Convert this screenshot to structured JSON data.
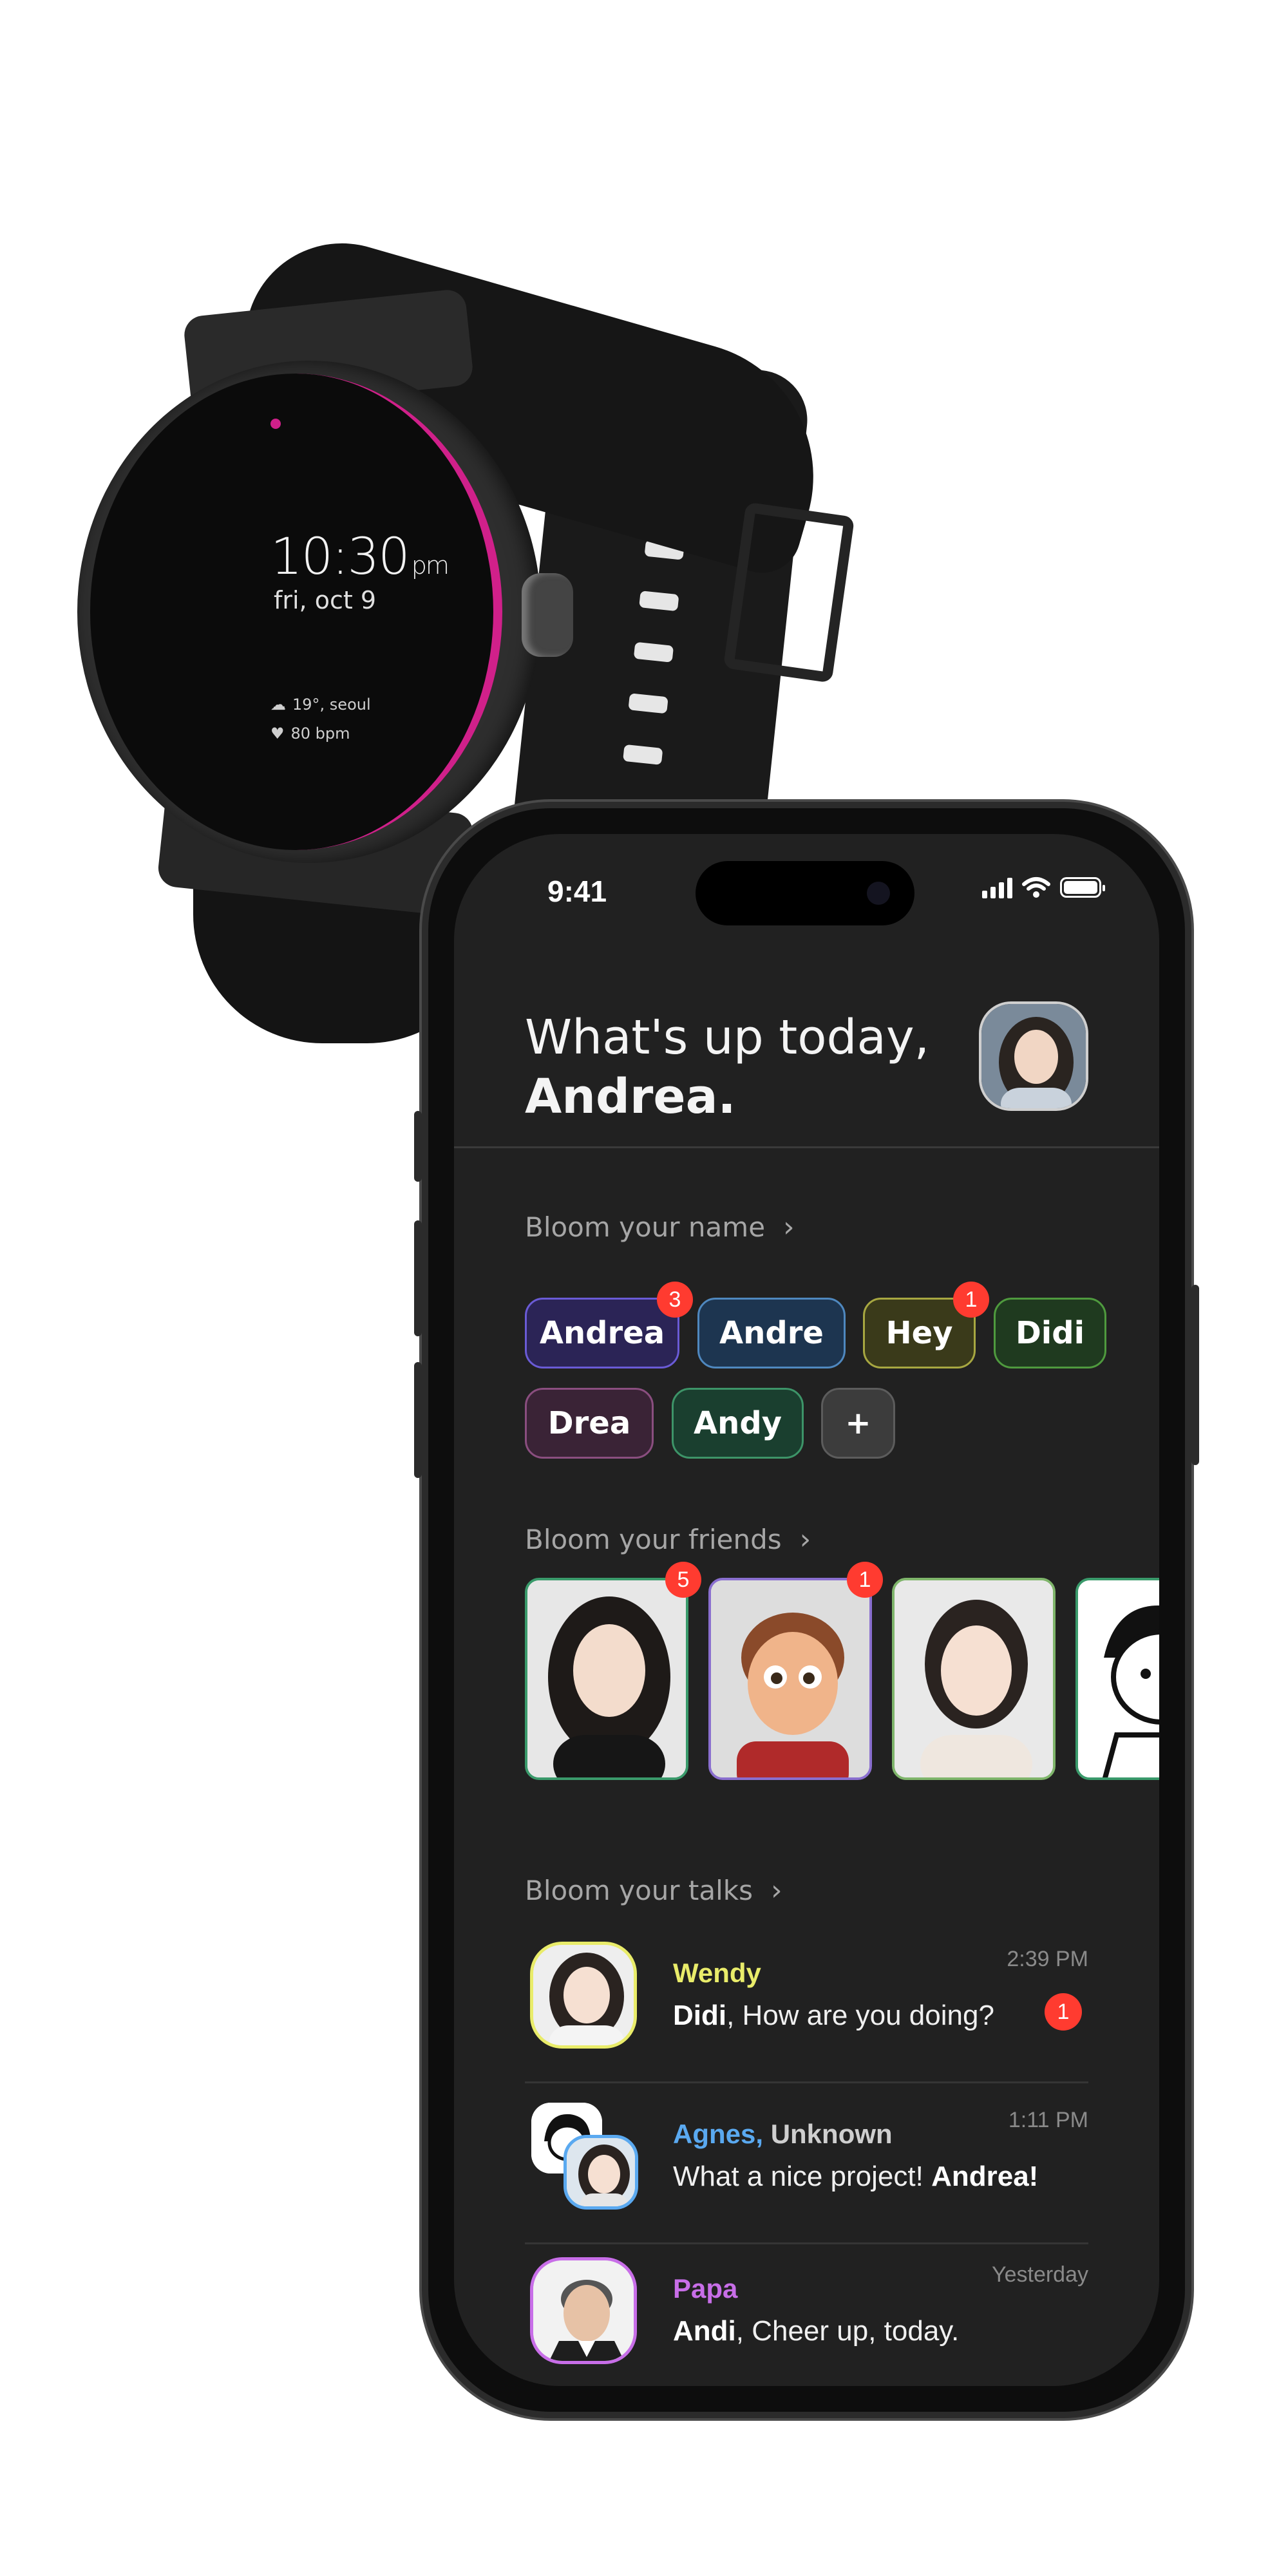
{
  "watch": {
    "time": "10:30",
    "ampm": "pm",
    "date": "fri, oct 9",
    "weather": "19°, seoul",
    "heart": "80 bpm",
    "accent": "#d0208a"
  },
  "status_bar": {
    "time": "9:41"
  },
  "header": {
    "greeting_line1": "What's up today,",
    "greeting_name": "Andrea."
  },
  "names_section": {
    "title": "Bloom your name",
    "chips": [
      {
        "label": "Andrea",
        "badge": "3",
        "fill": "#2b2456",
        "border": "#6a5bd6"
      },
      {
        "label": "Andre",
        "badge": "",
        "fill": "#1d3550",
        "border": "#4f88bf"
      },
      {
        "label": "Hey",
        "badge": "1",
        "fill": "#3a3a1a",
        "border": "#a7a741"
      },
      {
        "label": "Didi",
        "badge": "",
        "fill": "#1f3a1f",
        "border": "#4f9a3e"
      },
      {
        "label": "Drea",
        "badge": "",
        "fill": "#3a2336",
        "border": "#8a4e7f"
      },
      {
        "label": "Andy",
        "badge": "",
        "fill": "#1a3f2f",
        "border": "#3d9468"
      },
      {
        "label": "+",
        "badge": "",
        "fill": "#3c3c3c",
        "border": "#5c5c5c"
      }
    ]
  },
  "friends_section": {
    "title": "Bloom your friends",
    "friends": [
      {
        "badge": "5",
        "border": "#3a9a6b"
      },
      {
        "badge": "1",
        "border": "#8a6fcf"
      },
      {
        "badge": "",
        "border": "#7fb56b"
      },
      {
        "badge": "",
        "border": "#3a9a6b"
      }
    ]
  },
  "talks_section": {
    "title": "Bloom your talks",
    "talks": [
      {
        "name": "Wendy",
        "name_extra": "",
        "name_color": "#e9ec6a",
        "sender": "Didi",
        "message": ", How are you doing?",
        "message_tail": "",
        "time": "2:39 PM",
        "badge": "1",
        "avatar_border": "#e9ec6a"
      },
      {
        "name": "Agnes,",
        "name_extra": " Unknown",
        "name_color": "#5aa9f0",
        "sender": "",
        "message": "What a nice project! ",
        "message_tail": "Andrea!",
        "time": "1:11 PM",
        "badge": "",
        "avatar_border": "#5aa9f0"
      },
      {
        "name": "Papa",
        "name_extra": "",
        "name_color": "#c86ee8",
        "sender": "Andi",
        "message": ", Cheer up, today.",
        "message_tail": "",
        "time": "Yesterday",
        "badge": "",
        "avatar_border": "#c86ee8"
      }
    ]
  }
}
